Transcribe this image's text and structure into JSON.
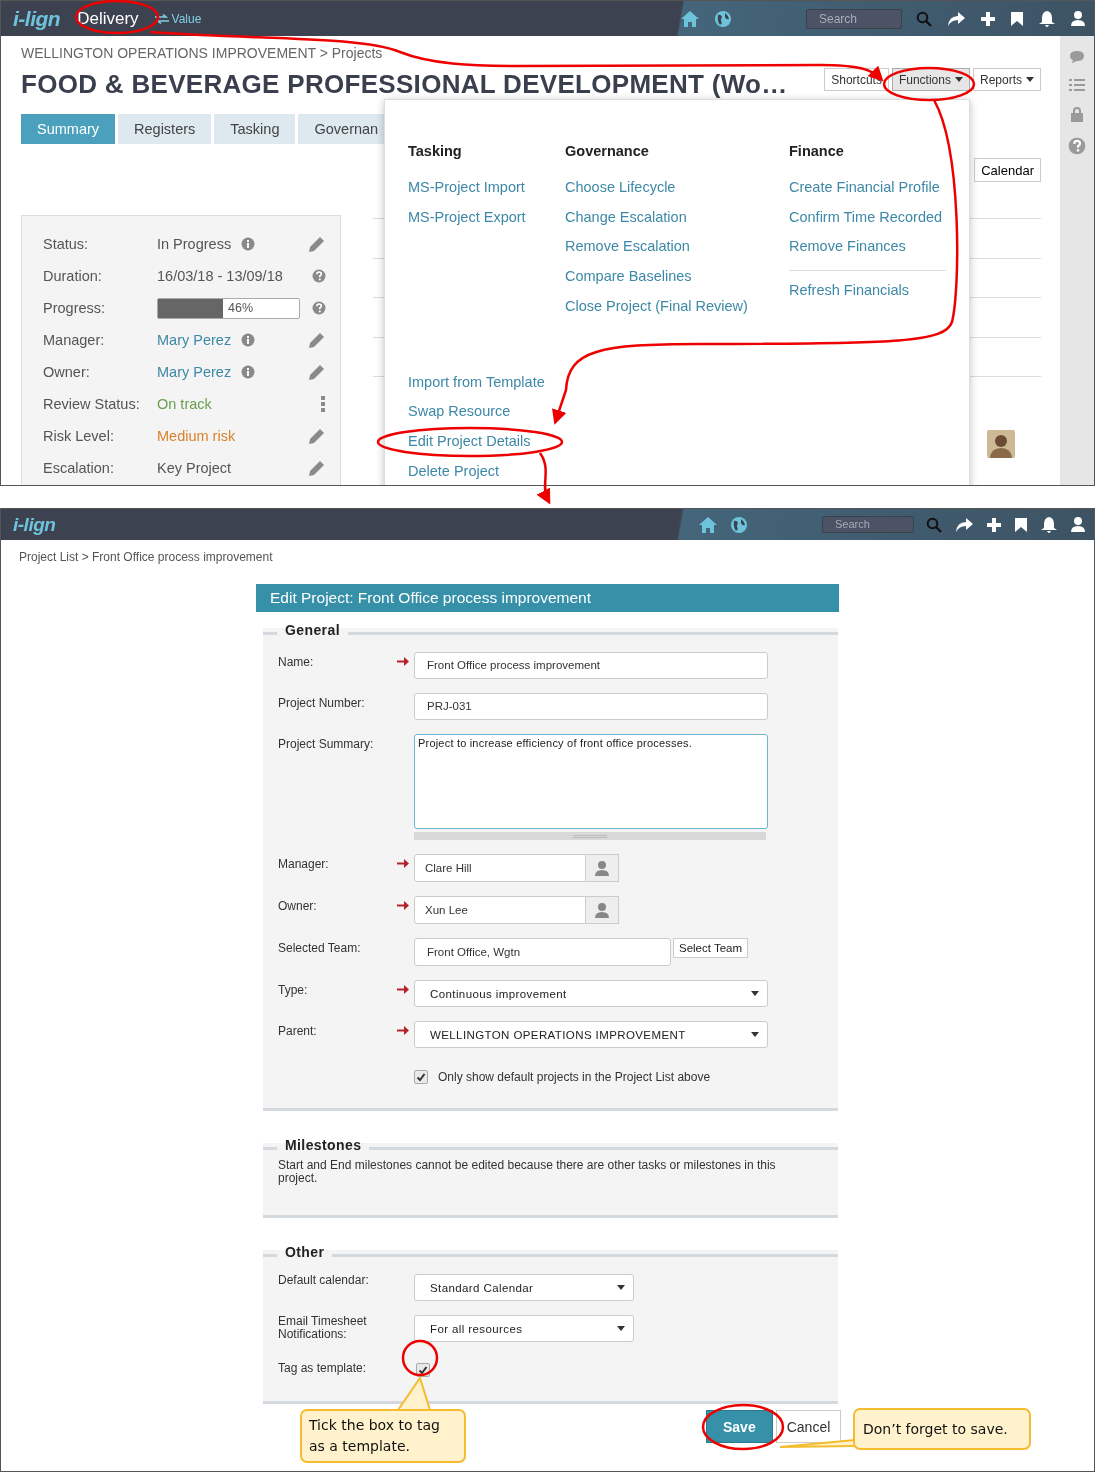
{
  "top": {
    "header": {
      "logo": "i-lign",
      "module": "Delivery",
      "switch": "Value",
      "search_placeholder": "Search"
    },
    "breadcrumb": "WELLINGTON OPERATIONS IMPROVEMENT > Projects",
    "title": "FOOD & BEVERAGE PROFESSIONAL DEVELOPMENT (Wo…",
    "action_buttons": [
      {
        "label": "Shortcuts",
        "selected": false
      },
      {
        "label": "Functions",
        "selected": true
      },
      {
        "label": "Reports",
        "selected": false
      }
    ],
    "tabs": [
      {
        "label": "Summary",
        "selected": true
      },
      {
        "label": "Registers",
        "selected": false
      },
      {
        "label": "Tasking",
        "selected": false
      },
      {
        "label": "Governan",
        "selected": false
      }
    ],
    "summary": [
      {
        "label": "Status:",
        "kind": "text",
        "value": "In Progress",
        "info": true,
        "action": {
          "kind": "edit"
        }
      },
      {
        "label": "Duration:",
        "kind": "text",
        "value": "16/03/18 - 13/09/18",
        "info": false,
        "action": {
          "kind": "help"
        }
      },
      {
        "label": "Progress:",
        "kind": "progress",
        "value": "46%",
        "level": 0.46,
        "info": false,
        "action": {
          "kind": "help"
        }
      },
      {
        "label": "Manager:",
        "kind": "link",
        "value": "Mary Perez",
        "info": true,
        "action": {
          "kind": "edit"
        }
      },
      {
        "label": "Owner:",
        "kind": "link",
        "value": "Mary Perez",
        "info": true,
        "action": {
          "kind": "edit"
        }
      },
      {
        "label": "Review Status:",
        "kind": "status",
        "value": "On track",
        "color": "#6a9f4f",
        "info": false,
        "action": {
          "kind": "more"
        }
      },
      {
        "label": "Risk Level:",
        "kind": "status",
        "value": "Medium risk",
        "color": "#d9822b",
        "info": false,
        "action": {
          "kind": "edit"
        }
      },
      {
        "label": "Escalation:",
        "kind": "text",
        "value": "Key Project",
        "info": false,
        "action": {
          "kind": "edit"
        }
      }
    ],
    "calendar_button": "Calendar",
    "functions_menu": {
      "columns": [
        {
          "heading": "Tasking",
          "items": [
            "MS-Project Import",
            "MS-Project Export"
          ]
        },
        {
          "heading": "Governance",
          "items": [
            "Choose Lifecycle",
            "Change Escalation",
            "Remove Escalation",
            "Compare Baselines",
            "Close Project (Final Review)"
          ]
        },
        {
          "heading": "Finance",
          "items": [
            "Create Financial Profile",
            "Confirm Time Recorded",
            "Remove Finances"
          ],
          "items_after_divider": [
            "Refresh Financials"
          ]
        }
      ],
      "more_items": [
        "Import from Template",
        "Swap Resource",
        "Edit Project Details",
        "Delete Project"
      ]
    }
  },
  "bottom": {
    "header": {
      "logo": "i-lign",
      "search_placeholder": "Search"
    },
    "breadcrumb": "Project List > Front Office process improvement",
    "form": {
      "title": "Edit Project: Front Office process improvement",
      "sections": [
        {
          "heading": "General",
          "kind": "fields",
          "fields": [
            {
              "label": "Name:",
              "kind": "input",
              "required": true,
              "value": "Front Office process improvement"
            },
            {
              "label": "Project Number:",
              "kind": "input",
              "required": false,
              "value": "PRJ-031"
            },
            {
              "label": "Project Summary:",
              "kind": "textarea",
              "required": false,
              "value": "Project to increase efficiency of front office processes."
            },
            {
              "label": "Manager:",
              "kind": "person",
              "required": true,
              "value": "Clare Hill"
            },
            {
              "label": "Owner:",
              "kind": "person",
              "required": true,
              "value": "Xun Lee"
            },
            {
              "label": "Selected Team:",
              "kind": "team",
              "required": false,
              "value": "Front Office, Wgtn",
              "button": "Select Team"
            },
            {
              "label": "Type:",
              "kind": "select",
              "required": true,
              "value": "Continuous improvement"
            },
            {
              "label": "Parent:",
              "kind": "select",
              "required": true,
              "value": "WELLINGTON OPERATIONS IMPROVEMENT"
            },
            {
              "label": "Only show default projects in the Project List above",
              "kind": "checkbox",
              "checked": true
            }
          ]
        },
        {
          "heading": "Milestones",
          "kind": "note",
          "text": "Start and End milestones cannot be edited because there are other tasks or milestones in this project."
        },
        {
          "heading": "Other",
          "kind": "fields",
          "fields": [
            {
              "label": "Default calendar:",
              "kind": "select",
              "value": "Standard Calendar"
            },
            {
              "label": "Email Timesheet Notifications:",
              "kind": "select",
              "value": "For all resources"
            },
            {
              "label": "Tag as template:",
              "kind": "tick",
              "checked": true
            }
          ]
        }
      ],
      "buttons": [
        {
          "label": "Save",
          "kind": "primary"
        },
        {
          "label": "Cancel",
          "kind": "secondary"
        }
      ]
    }
  },
  "callouts": [
    {
      "text": "Tick the box to tag as a template.",
      "kind": "up"
    },
    {
      "text": "Don’t forget to save.",
      "kind": "left"
    }
  ]
}
